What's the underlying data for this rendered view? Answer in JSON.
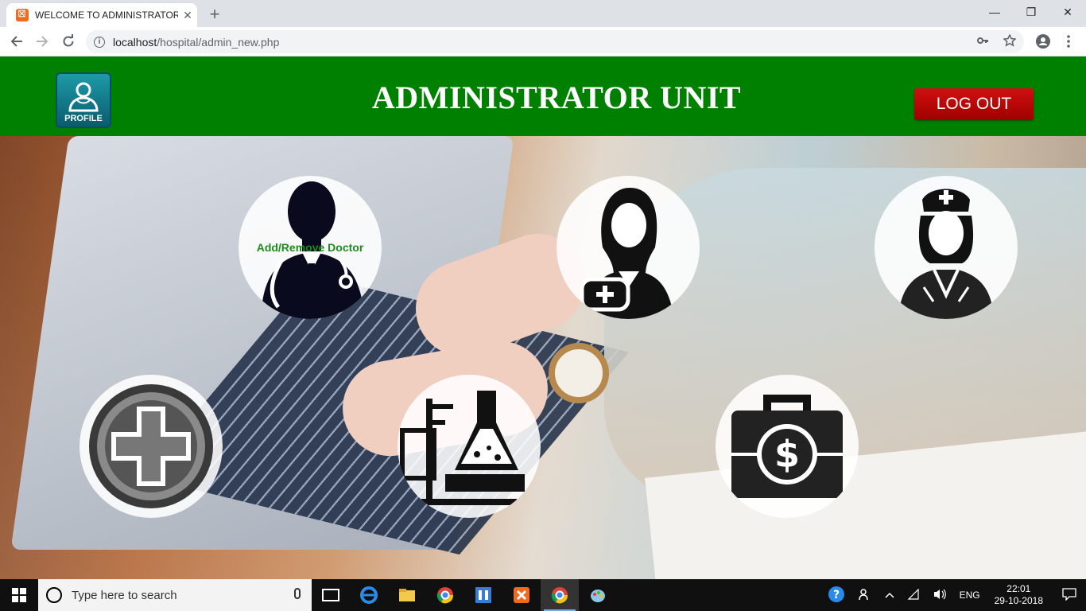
{
  "browser": {
    "tab_title": "WELCOME TO ADMINISTRATOR U",
    "tab_close": "✕",
    "new_tab": "+",
    "url_host": "localhost",
    "url_path": "/hospital/admin_new.php",
    "controls": {
      "minimize": "—",
      "restore": "❐",
      "close": "✕"
    }
  },
  "header": {
    "title": "ADMINISTRATOR UNIT",
    "profile_label": "PROFILE",
    "logout_label": "LOG OUT",
    "bg_color": "#008000"
  },
  "tiles": [
    {
      "icon": "doctor-icon",
      "label": "Add/Remove Doctor"
    },
    {
      "icon": "female-doctor-icon",
      "label": ""
    },
    {
      "icon": "nurse-icon",
      "label": ""
    },
    {
      "icon": "medical-cross-icon",
      "label": ""
    },
    {
      "icon": "laboratory-icon",
      "label": ""
    },
    {
      "icon": "money-case-icon",
      "label": ""
    }
  ],
  "taskbar": {
    "search_placeholder": "Type here to search",
    "language": "ENG",
    "time": "22:01",
    "date": "29-10-2018"
  }
}
